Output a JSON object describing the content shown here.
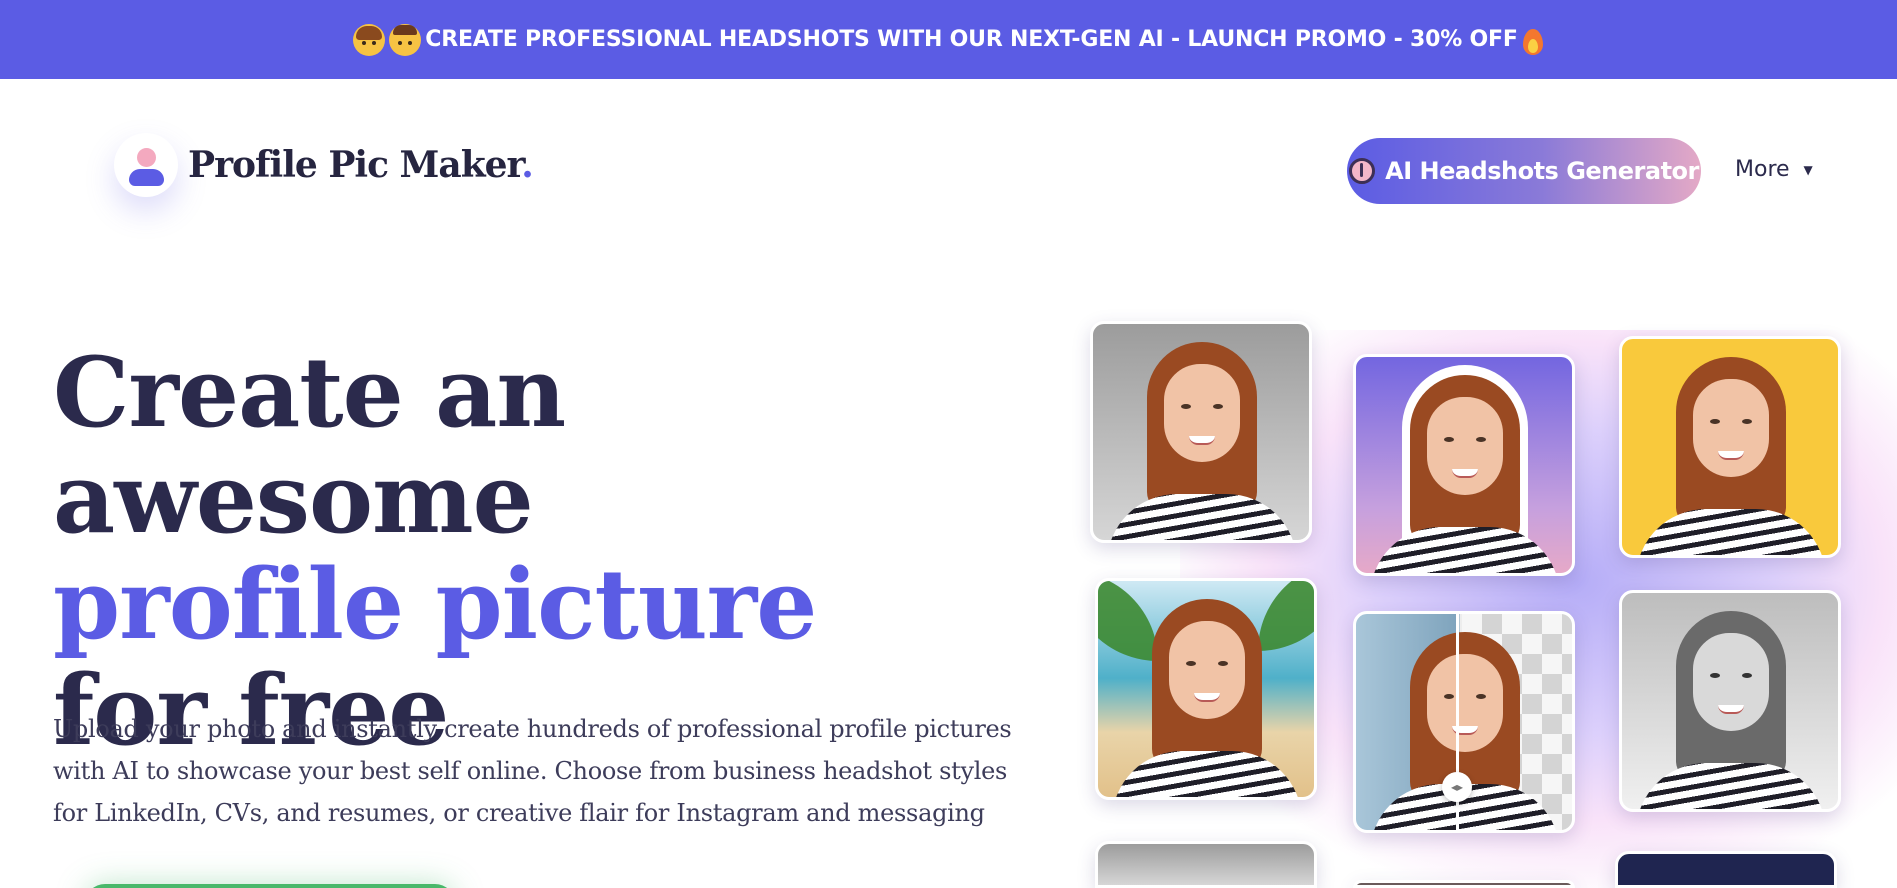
{
  "promo_banner": {
    "text": "CREATE PROFESSIONAL HEADSHOTS WITH OUR NEXT-GEN AI - LAUNCH PROMO - 30% OFF",
    "icons": [
      "woman-emoji-icon",
      "boy-emoji-icon",
      "fire-emoji-icon"
    ],
    "background": "#5b5ce4"
  },
  "header": {
    "logo_text": "Profile Pic Maker",
    "logo_dot": ".",
    "cta_label": "AI Headshots Generator",
    "more_label": "More",
    "more_caret": "▼"
  },
  "hero": {
    "title_line1": "Create an awesome",
    "title_line2": "profile picture",
    "title_line3": "for free",
    "description": "Upload your photo and instantly create hundreds of professional profile pictures with AI to showcase your best self online. Choose from business headshot styles for LinkedIn, CVs, and resumes, or creative flair for Instagram and messaging"
  },
  "gallery": {
    "tiles": [
      "gray-background",
      "purple-gradient-cutout",
      "yellow-background",
      "beach-background",
      "background-removal-comparison",
      "black-and-white"
    ],
    "compare_handle": "◂▸"
  },
  "colors": {
    "accent": "#5b5ce4",
    "text_dark": "#2b2a4c",
    "cta_green": "#49b86a",
    "cta_gradient_end": "#e4a9c6"
  }
}
